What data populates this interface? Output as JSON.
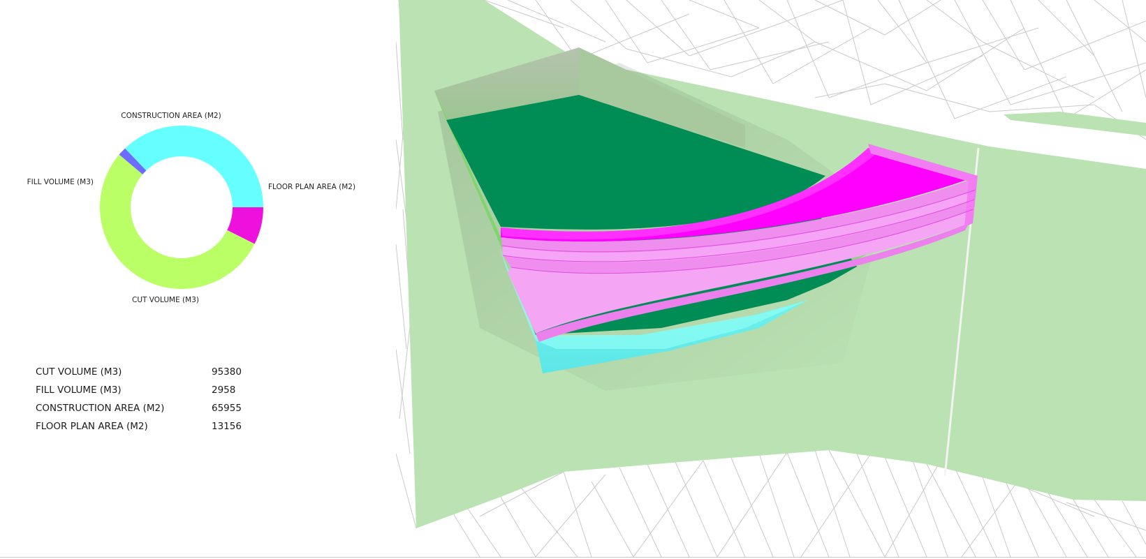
{
  "chart_data": {
    "type": "pie",
    "donut": true,
    "categories": [
      "FLOOR PLAN AREA (M2)",
      "CUT VOLUME (M3)",
      "FILL VOLUME (M3)",
      "CONSTRUCTION AREA (M2)"
    ],
    "values": [
      13156,
      95380,
      2958,
      65955
    ],
    "colors": [
      "#ee11dd",
      "#bbff66",
      "#6e6cff",
      "#66ffff"
    ],
    "legend": "labels-around"
  },
  "stats": {
    "rows": [
      {
        "label": "CUT VOLUME (M3)",
        "value": "95380"
      },
      {
        "label": "FILL VOLUME (M3)",
        "value": "2958"
      },
      {
        "label": "CONSTRUCTION AREA (M2)",
        "value": "65955"
      },
      {
        "label": "FLOOR PLAN AREA (M2)",
        "value": "13156"
      }
    ]
  },
  "viewport": {
    "colors": {
      "terrain": "#bbe2b3",
      "excavation_floor": "#008c55",
      "building": "#ff00ff",
      "fill_base": "#66ffff",
      "mesh_lines": "#c9c9c9"
    }
  }
}
